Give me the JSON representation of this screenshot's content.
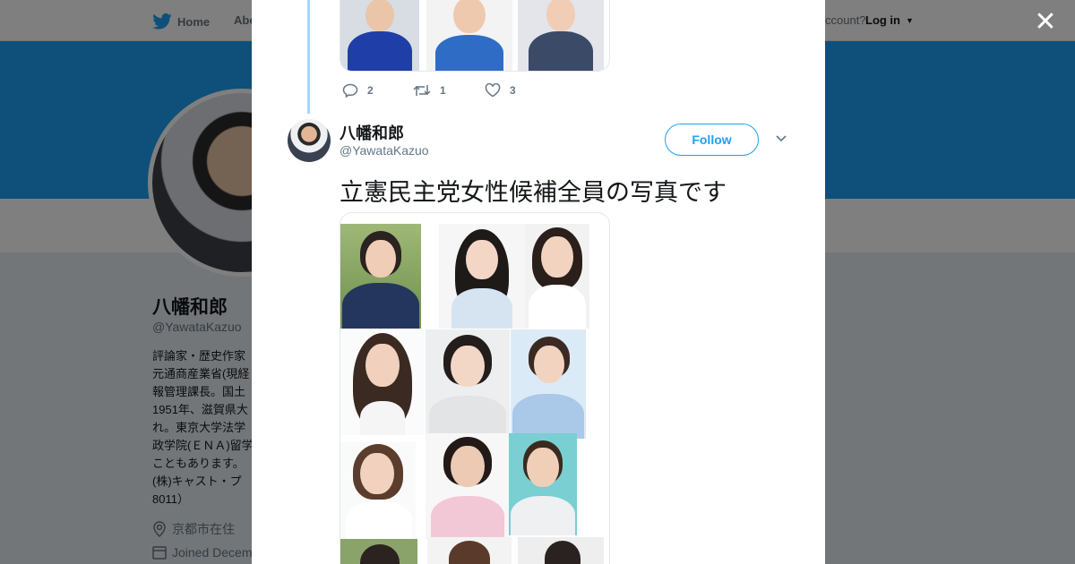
{
  "background_page": {
    "nav": {
      "home_label": "Home",
      "about_label": "Abo",
      "account_text": "ccount?",
      "login_label": "Log in"
    },
    "profile": {
      "name": "八幡和郎",
      "handle": "@YawataKazuo",
      "bio": "評論家・歴史作家\n元通商産業省(現経\n報管理課長。国土\n1951年、滋賀県大\nれ。東京大学法学\n政学院(ＥＮＡ)留学\nこともあります。\n(株)キャスト・プ\n8011）",
      "location": "京都市在住",
      "joined": "Joined Decem"
    }
  },
  "modal": {
    "close_icon": "close-icon",
    "prev_tweet": {
      "reply_count": "2",
      "retweet_count": "1",
      "like_count": "3"
    },
    "tweet": {
      "author_name": "八幡和郎",
      "author_handle": "@YawataKazuo",
      "follow_label": "Follow",
      "text": "立憲民主党女性候補全員の写真です"
    }
  },
  "colors": {
    "accent": "#1da1f2",
    "thread_line": "#a8d6f8",
    "muted": "#657786"
  }
}
